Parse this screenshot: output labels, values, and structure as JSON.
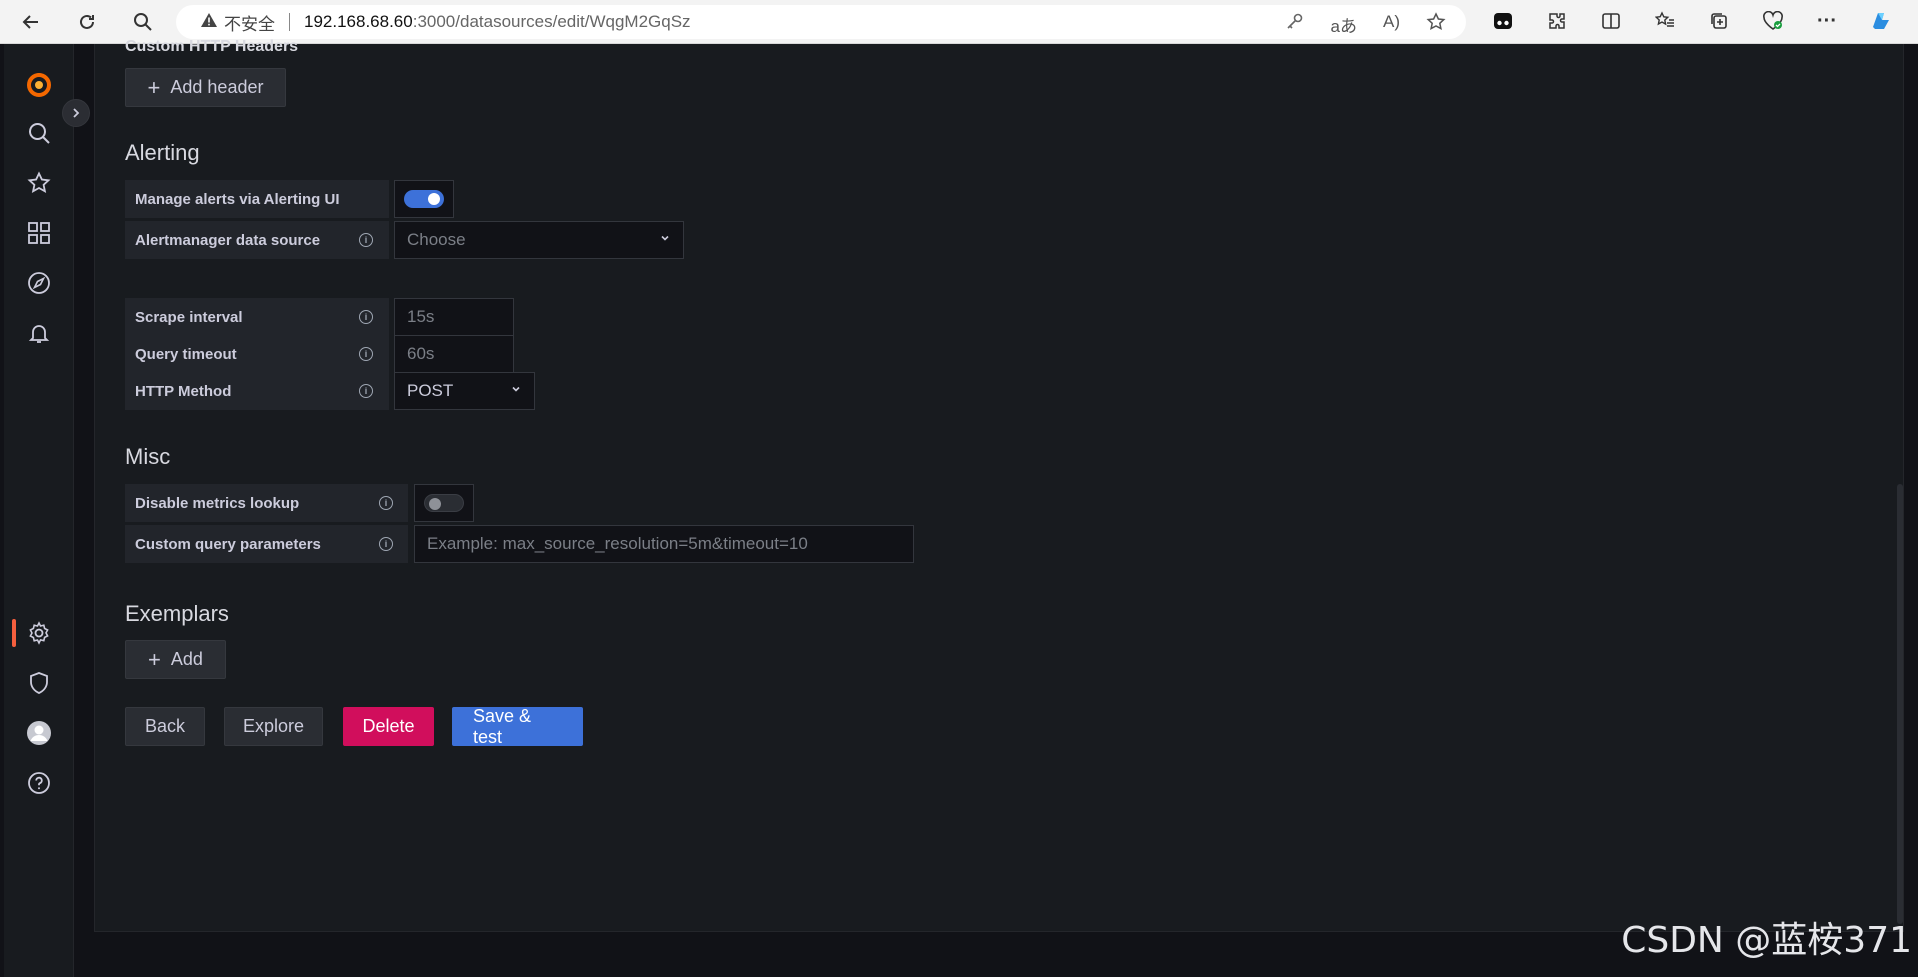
{
  "browser": {
    "security": "不安全",
    "url_host": "192.168.68.60",
    "url_path": ":3000/datasources/edit/WqgM2GqSz"
  },
  "sidenav": {
    "items": [
      "grafana-logo",
      "search-icon",
      "star-icon",
      "dashboards-icon",
      "explore-icon",
      "alerting-icon",
      "configuration-icon",
      "shield-icon",
      "avatar-icon",
      "help-icon"
    ]
  },
  "headers": {
    "title": "Custom HTTP Headers",
    "add_label": "Add header"
  },
  "alerting": {
    "title": "Alerting",
    "manage_label": "Manage alerts via Alerting UI",
    "manage_enabled": true,
    "alertmanager_label": "Alertmanager data source",
    "alertmanager_placeholder": "Choose"
  },
  "settings": {
    "scrape_label": "Scrape interval",
    "scrape_placeholder": "15s",
    "timeout_label": "Query timeout",
    "timeout_placeholder": "60s",
    "method_label": "HTTP Method",
    "method_value": "POST"
  },
  "misc": {
    "title": "Misc",
    "disable_label": "Disable metrics lookup",
    "disable_enabled": false,
    "params_label": "Custom query parameters",
    "params_placeholder": "Example: max_source_resolution=5m&timeout=10"
  },
  "exemplars": {
    "title": "Exemplars",
    "add_label": "Add"
  },
  "actions": {
    "back": "Back",
    "explore": "Explore",
    "delete": "Delete",
    "save": "Save & test"
  },
  "watermark": "CSDN @蓝桉371",
  "colors": {
    "primary": "#3d71d9",
    "danger": "#d10e5c",
    "accent": "#f55f3e"
  }
}
